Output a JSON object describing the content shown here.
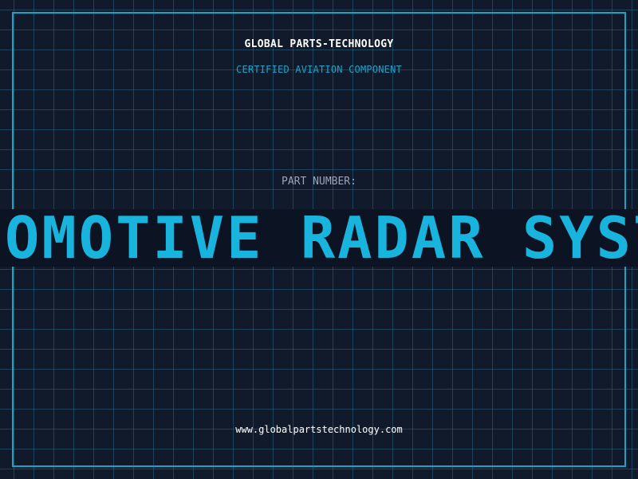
{
  "company_name": "GLOBAL PARTS-TECHNOLOGY",
  "certification": "CERTIFIED AVIATION COMPONENT",
  "part_number_label": "PART NUMBER:",
  "part_number_value": "AUTOMOTIVE RADAR SYSTEM",
  "website": "www.globalpartstechnology.com",
  "colors": {
    "background": "#111a2b",
    "grid": "#28788f",
    "accent": "#1aa3c8",
    "banner": "#0c1322"
  }
}
